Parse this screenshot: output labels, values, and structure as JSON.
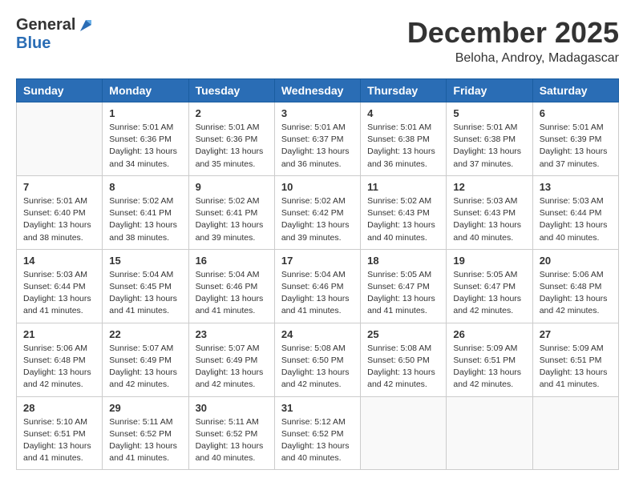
{
  "header": {
    "logo_general": "General",
    "logo_blue": "Blue",
    "month": "December 2025",
    "location": "Beloha, Androy, Madagascar"
  },
  "weekdays": [
    "Sunday",
    "Monday",
    "Tuesday",
    "Wednesday",
    "Thursday",
    "Friday",
    "Saturday"
  ],
  "weeks": [
    [
      {
        "day": "",
        "info": ""
      },
      {
        "day": "1",
        "info": "Sunrise: 5:01 AM\nSunset: 6:36 PM\nDaylight: 13 hours\nand 34 minutes."
      },
      {
        "day": "2",
        "info": "Sunrise: 5:01 AM\nSunset: 6:36 PM\nDaylight: 13 hours\nand 35 minutes."
      },
      {
        "day": "3",
        "info": "Sunrise: 5:01 AM\nSunset: 6:37 PM\nDaylight: 13 hours\nand 36 minutes."
      },
      {
        "day": "4",
        "info": "Sunrise: 5:01 AM\nSunset: 6:38 PM\nDaylight: 13 hours\nand 36 minutes."
      },
      {
        "day": "5",
        "info": "Sunrise: 5:01 AM\nSunset: 6:38 PM\nDaylight: 13 hours\nand 37 minutes."
      },
      {
        "day": "6",
        "info": "Sunrise: 5:01 AM\nSunset: 6:39 PM\nDaylight: 13 hours\nand 37 minutes."
      }
    ],
    [
      {
        "day": "7",
        "info": "Sunrise: 5:01 AM\nSunset: 6:40 PM\nDaylight: 13 hours\nand 38 minutes."
      },
      {
        "day": "8",
        "info": "Sunrise: 5:02 AM\nSunset: 6:41 PM\nDaylight: 13 hours\nand 38 minutes."
      },
      {
        "day": "9",
        "info": "Sunrise: 5:02 AM\nSunset: 6:41 PM\nDaylight: 13 hours\nand 39 minutes."
      },
      {
        "day": "10",
        "info": "Sunrise: 5:02 AM\nSunset: 6:42 PM\nDaylight: 13 hours\nand 39 minutes."
      },
      {
        "day": "11",
        "info": "Sunrise: 5:02 AM\nSunset: 6:43 PM\nDaylight: 13 hours\nand 40 minutes."
      },
      {
        "day": "12",
        "info": "Sunrise: 5:03 AM\nSunset: 6:43 PM\nDaylight: 13 hours\nand 40 minutes."
      },
      {
        "day": "13",
        "info": "Sunrise: 5:03 AM\nSunset: 6:44 PM\nDaylight: 13 hours\nand 40 minutes."
      }
    ],
    [
      {
        "day": "14",
        "info": "Sunrise: 5:03 AM\nSunset: 6:44 PM\nDaylight: 13 hours\nand 41 minutes."
      },
      {
        "day": "15",
        "info": "Sunrise: 5:04 AM\nSunset: 6:45 PM\nDaylight: 13 hours\nand 41 minutes."
      },
      {
        "day": "16",
        "info": "Sunrise: 5:04 AM\nSunset: 6:46 PM\nDaylight: 13 hours\nand 41 minutes."
      },
      {
        "day": "17",
        "info": "Sunrise: 5:04 AM\nSunset: 6:46 PM\nDaylight: 13 hours\nand 41 minutes."
      },
      {
        "day": "18",
        "info": "Sunrise: 5:05 AM\nSunset: 6:47 PM\nDaylight: 13 hours\nand 41 minutes."
      },
      {
        "day": "19",
        "info": "Sunrise: 5:05 AM\nSunset: 6:47 PM\nDaylight: 13 hours\nand 42 minutes."
      },
      {
        "day": "20",
        "info": "Sunrise: 5:06 AM\nSunset: 6:48 PM\nDaylight: 13 hours\nand 42 minutes."
      }
    ],
    [
      {
        "day": "21",
        "info": "Sunrise: 5:06 AM\nSunset: 6:48 PM\nDaylight: 13 hours\nand 42 minutes."
      },
      {
        "day": "22",
        "info": "Sunrise: 5:07 AM\nSunset: 6:49 PM\nDaylight: 13 hours\nand 42 minutes."
      },
      {
        "day": "23",
        "info": "Sunrise: 5:07 AM\nSunset: 6:49 PM\nDaylight: 13 hours\nand 42 minutes."
      },
      {
        "day": "24",
        "info": "Sunrise: 5:08 AM\nSunset: 6:50 PM\nDaylight: 13 hours\nand 42 minutes."
      },
      {
        "day": "25",
        "info": "Sunrise: 5:08 AM\nSunset: 6:50 PM\nDaylight: 13 hours\nand 42 minutes."
      },
      {
        "day": "26",
        "info": "Sunrise: 5:09 AM\nSunset: 6:51 PM\nDaylight: 13 hours\nand 42 minutes."
      },
      {
        "day": "27",
        "info": "Sunrise: 5:09 AM\nSunset: 6:51 PM\nDaylight: 13 hours\nand 41 minutes."
      }
    ],
    [
      {
        "day": "28",
        "info": "Sunrise: 5:10 AM\nSunset: 6:51 PM\nDaylight: 13 hours\nand 41 minutes."
      },
      {
        "day": "29",
        "info": "Sunrise: 5:11 AM\nSunset: 6:52 PM\nDaylight: 13 hours\nand 41 minutes."
      },
      {
        "day": "30",
        "info": "Sunrise: 5:11 AM\nSunset: 6:52 PM\nDaylight: 13 hours\nand 40 minutes."
      },
      {
        "day": "31",
        "info": "Sunrise: 5:12 AM\nSunset: 6:52 PM\nDaylight: 13 hours\nand 40 minutes."
      },
      {
        "day": "",
        "info": ""
      },
      {
        "day": "",
        "info": ""
      },
      {
        "day": "",
        "info": ""
      }
    ]
  ]
}
